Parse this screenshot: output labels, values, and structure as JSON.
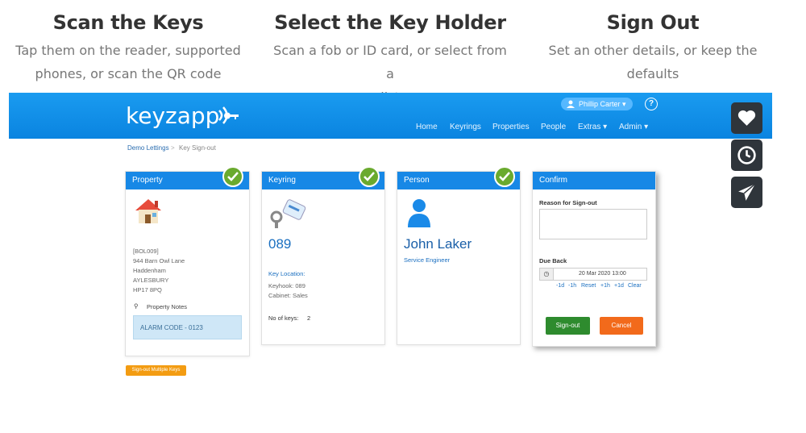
{
  "steps": [
    {
      "title": "Scan the Keys",
      "line1": "Tap them on the reader, supported",
      "line2": "phones, or scan the QR code"
    },
    {
      "title": "Select the Key Holder",
      "line1": "Scan a fob or ID card, or select from a",
      "line2": "list"
    },
    {
      "title": "Sign Out",
      "line1": "Set an other details, or keep the",
      "line2": "defaults"
    }
  ],
  "app": {
    "logo": "keyzapp",
    "user": "Phillip Carter",
    "nav": [
      "Home",
      "Keyrings",
      "Properties",
      "People",
      "Extras ▾",
      "Admin ▾"
    ]
  },
  "breadcrumb": {
    "parent": "Demo Lettings",
    "separator": ">",
    "current": "Key Sign-out"
  },
  "property": {
    "header": "Property",
    "ref": "[BOL009]",
    "address": [
      "944 Barn Owl Lane",
      "Haddenham",
      "AYLESBURY",
      "HP17 8PQ"
    ],
    "notes_label": "Property Notes",
    "notes": "ALARM CODE - 0123"
  },
  "keyring": {
    "header": "Keyring",
    "number": "089",
    "location_label": "Key Location:",
    "keyhook": "Keyhook: 089",
    "cabinet": "Cabinet: Sales",
    "keys_label": "No of keys:",
    "keys_count": "2"
  },
  "person": {
    "header": "Person",
    "name": "John Laker",
    "role": "Service Engineer"
  },
  "confirm": {
    "header": "Confirm",
    "reason_label": "Reason for Sign-out",
    "due_label": "Due Back",
    "due_value": "20 Mar 2020  13:00",
    "quick": [
      "-1d",
      "-1h",
      "Reset",
      "+1h",
      "+1d",
      "Clear"
    ],
    "signout": "Sign-out",
    "cancel": "Cancel"
  },
  "multi_button": "Sign-out Multiple Keys",
  "colors": {
    "header_blue": "#0a84e0",
    "panel_blue": "#1788e6",
    "check_green": "#6aaa2e",
    "signout_green": "#2e8b2e",
    "cancel_orange": "#f26a1b",
    "multi_orange": "#f39c12"
  },
  "float_icons": [
    "heart-icon",
    "clock-icon",
    "send-icon"
  ]
}
